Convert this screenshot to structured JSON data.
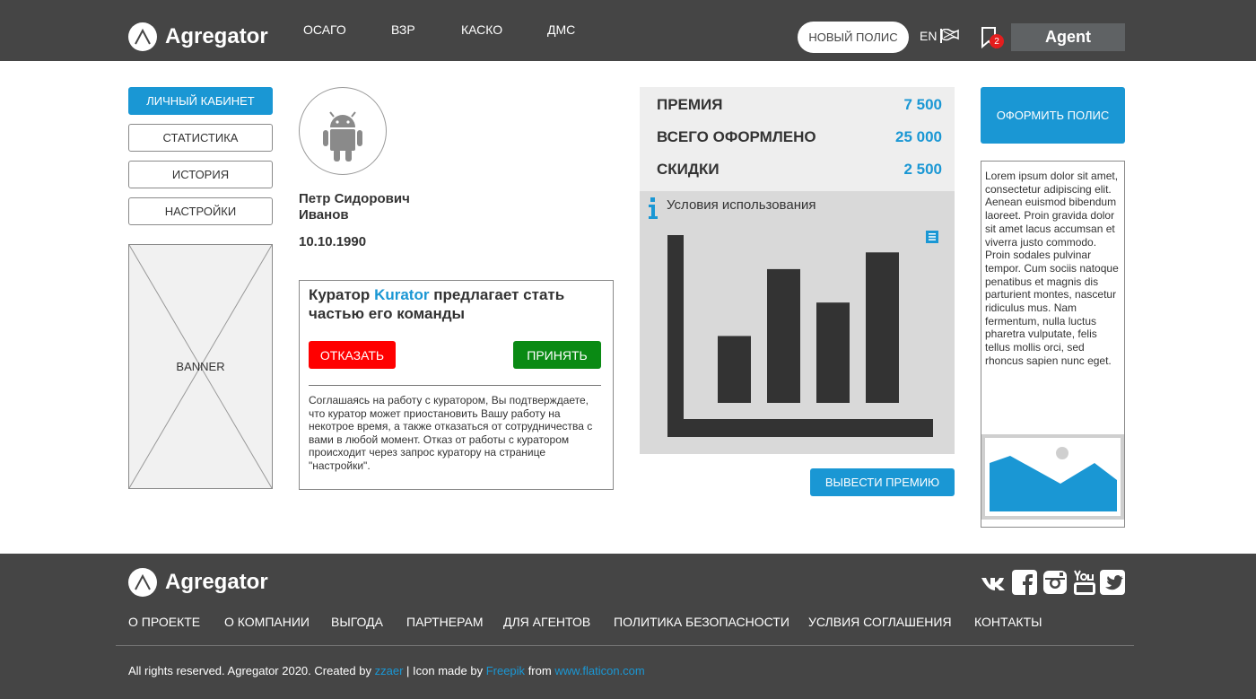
{
  "header": {
    "brand": "Agregator",
    "nav": [
      "ОСАГО",
      "ВЗР",
      "КАСКО",
      "ДМС"
    ],
    "new_policy": "НОВЫЙ ПОЛИС",
    "lang": "EN",
    "notifications": "2",
    "user": "Agent"
  },
  "sidebar": {
    "items": [
      "ЛИЧНЫЙ КАБИНЕТ",
      "СТАТИСТИКА",
      "ИСТОРИЯ",
      "НАСТРОЙКИ"
    ],
    "active": "ЛИЧНЫЙ КАБИНЕТ",
    "banner": "BANNER"
  },
  "profile": {
    "first_line": "Петр Сидорович",
    "last_line": "Иванов",
    "dob": "10.10.1990"
  },
  "invite": {
    "prefix": "Куратор",
    "curator": "Kurator",
    "suffix": "предлагает стать частью его команды",
    "decline": "ОТКАЗАТЬ",
    "accept": "ПРИНЯТЬ",
    "note": "Соглашаясь на работу с куратором, Вы подтверждаете, что куратор может приостановить Вашу работу на некотрое время, а также отказаться от сотрудничества с вами в любой момент. Отказ от работы с куратором происходит через запрос куратору на странице \"настройки\"."
  },
  "stats": [
    {
      "label": "ПРЕМИЯ",
      "value": "7 500"
    },
    {
      "label": "ВСЕГО ОФОРМЛЕНО",
      "value": "25 000"
    },
    {
      "label": "СКИДКИ",
      "value": "2 500"
    }
  ],
  "panel": {
    "title": "Условия использования",
    "info_icon": "info-icon",
    "menu_icon": "menu-icon"
  },
  "chart_data": {
    "type": "bar",
    "categories": [
      "",
      "",
      "",
      ""
    ],
    "values": [
      2,
      4,
      3,
      4.5
    ],
    "title": "",
    "xlabel": "",
    "ylabel": "",
    "ylim": [
      0,
      5.5
    ],
    "grid": false,
    "bar_color": "#333333",
    "axis_color": "#333333"
  },
  "actions": {
    "withdraw": "ВЫВЕСТИ ПРЕМИЮ",
    "issue": "ОФОРМИТЬ ПОЛИС"
  },
  "lorem": "Lorem ipsum dolor sit amet, consectetur adipiscing elit. Aenean euismod bibendum laoreet. Proin gravida dolor sit amet lacus accumsan et viverra justo commodo. Proin sodales pulvinar tempor. Cum sociis natoque penatibus et magnis dis parturient montes, nascetur ridiculus mus. Nam fermentum, nulla luctus pharetra vulputate, felis tellus mollis orci, sed rhoncus sapien nunc eget.",
  "footer": {
    "brand": "Agregator",
    "nav": [
      "О ПРОЕКТЕ",
      "О КОМПАНИИ",
      "ВЫГОДА",
      "ПАРТНЕРАМ",
      "ДЛЯ АГЕНТОВ",
      "ПОЛИТИКА БЕЗОПАСНОСТИ",
      "УСЛВИЯ СОГЛАШЕНИЯ",
      "КОНТАКТЫ"
    ],
    "copyright_prefix": "All  rights reserved. Agregator 2020. Created by",
    "author": "zzaer",
    "icon_prefix": "| Icon made by",
    "icon_author": "Freepik",
    "from": "from",
    "site": "www.flaticon.com",
    "social": [
      "vk-icon",
      "facebook-icon",
      "instagram-icon",
      "youtube-icon",
      "twitter-icon"
    ]
  },
  "colors": {
    "accent": "#1a97d4",
    "dark": "#454545",
    "decline": "#ff0000",
    "accept": "#0a8a14"
  }
}
